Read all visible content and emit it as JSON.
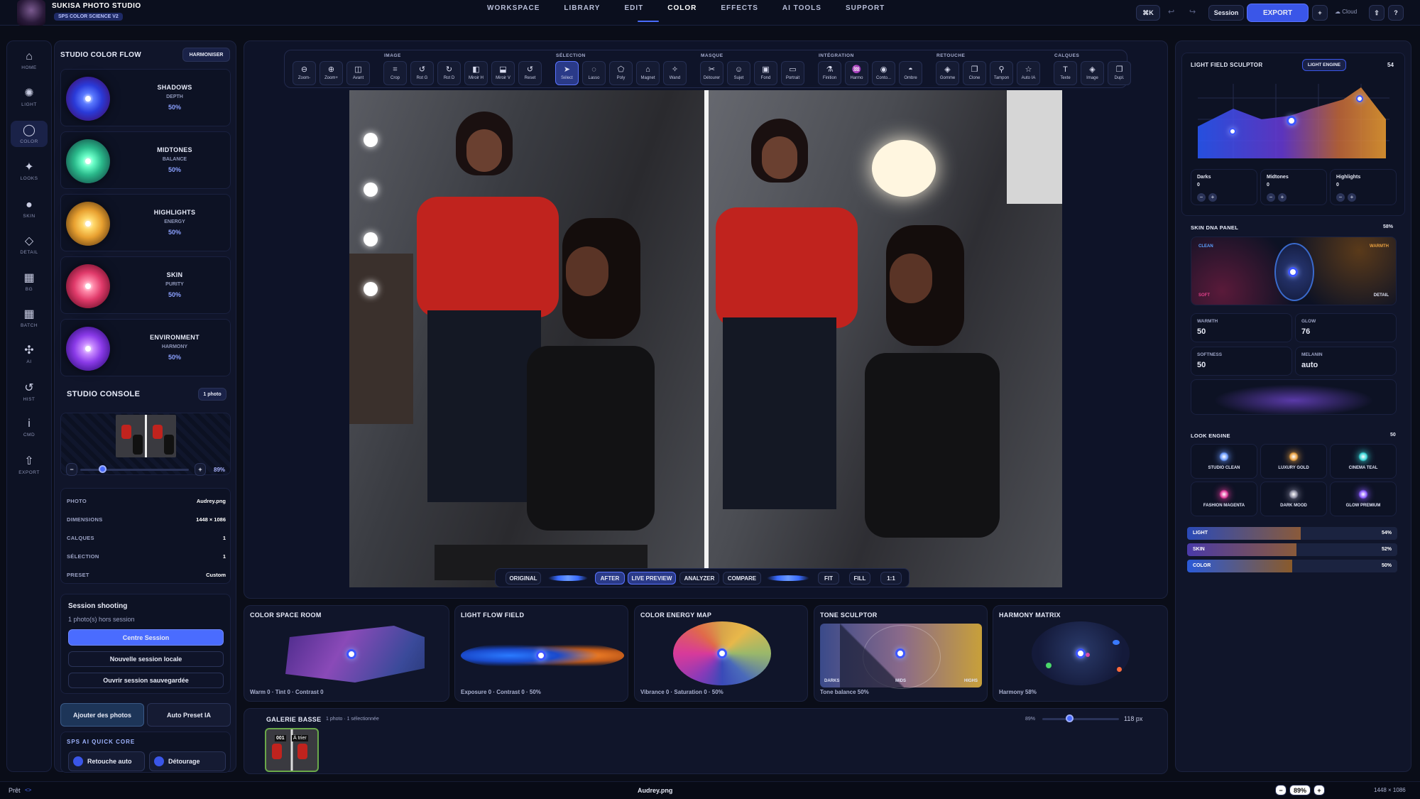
{
  "app": {
    "title": "SUKISA PHOTO STUDIO",
    "subtitle": "SPS COLOR SCIENCE V2"
  },
  "nav": [
    "WORKSPACE",
    "LIBRARY",
    "EDIT",
    "COLOR",
    "EFFECTS",
    "AI TOOLS",
    "SUPPORT"
  ],
  "nav_active": "COLOR",
  "topright": {
    "shortcut": "⌘K",
    "session": "Session",
    "export": "EXPORT",
    "plus": "+",
    "cloud": "Cloud",
    "help": "?"
  },
  "sidebar": [
    {
      "label": "HOME",
      "icon": "home-icon",
      "glyph": "⌂"
    },
    {
      "label": "LIGHT",
      "icon": "sun-icon",
      "glyph": "✺"
    },
    {
      "label": "COLOR",
      "icon": "color-circle-icon",
      "glyph": "◯"
    },
    {
      "label": "LOOKS",
      "icon": "sparkle-icon",
      "glyph": "✦"
    },
    {
      "label": "SKIN",
      "icon": "dot-icon",
      "glyph": "●"
    },
    {
      "label": "DETAIL",
      "icon": "diamond-icon",
      "glyph": "◇"
    },
    {
      "label": "BG",
      "icon": "square-icon",
      "glyph": "▦"
    },
    {
      "label": "BATCH",
      "icon": "batch-icon",
      "glyph": "▦"
    },
    {
      "label": "AI",
      "icon": "move-icon",
      "glyph": "✣"
    },
    {
      "label": "HIST",
      "icon": "history-icon",
      "glyph": "↺"
    },
    {
      "label": "CMD",
      "icon": "info-icon",
      "glyph": "i"
    },
    {
      "label": "EXPORT",
      "icon": "upload-icon",
      "glyph": "⇧"
    }
  ],
  "colorflow": {
    "title": "STUDIO COLOR FLOW",
    "button": "HARMONISER",
    "wheels": [
      {
        "name": "SHADOWS",
        "sub": "DEPTH",
        "value": "50%"
      },
      {
        "name": "MIDTONES",
        "sub": "BALANCE",
        "value": "50%"
      },
      {
        "name": "HIGHLIGHTS",
        "sub": "ENERGY",
        "value": "50%"
      },
      {
        "name": "SKIN",
        "sub": "PURITY",
        "value": "50%"
      },
      {
        "name": "ENVIRONMENT",
        "sub": "HARMONY",
        "value": "50%"
      }
    ]
  },
  "console": {
    "title": "STUDIO CONSOLE",
    "badge": "1 photo",
    "zoom": "89%",
    "minus": "−",
    "plus": "+",
    "zoom_fraction": 0.2,
    "info": [
      {
        "k": "PHOTO",
        "v": "Audrey.png"
      },
      {
        "k": "DIMENSIONS",
        "v": "1448 × 1086"
      },
      {
        "k": "CALQUES",
        "v": "1"
      },
      {
        "k": "SÉLECTION",
        "v": "1"
      },
      {
        "k": "PRESET",
        "v": "Custom"
      }
    ]
  },
  "session": {
    "title": "Session shooting",
    "sub": "1 photo(s) hors session",
    "b1": "Centre Session",
    "b2": "Nouvelle session locale",
    "b3": "Ouvrir session sauvegardée",
    "add": "Ajouter des photos",
    "preset": "Auto Preset IA"
  },
  "quick": {
    "title": "SPS AI QUICK CORE",
    "a": "Retouche auto",
    "b": "Détourage"
  },
  "toolbar": [
    {
      "group": "",
      "tools": [
        "Zoom-",
        "Zoom+",
        "Avant"
      ],
      "glyphs": [
        "⊖",
        "⊕",
        "◫"
      ]
    },
    {
      "group": "IMAGE",
      "tools": [
        "Crop",
        "Rot G",
        "Rot D",
        "Miroir H",
        "Miroir V",
        "Reset"
      ],
      "glyphs": [
        "⌗",
        "↺",
        "↻",
        "◧",
        "⬓",
        "↺"
      ]
    },
    {
      "group": "SÉLECTION",
      "tools": [
        "Sélect",
        "Lasso",
        "Poly",
        "Magnet",
        "Wand"
      ],
      "glyphs": [
        "➤",
        "◌",
        "⬠",
        "⌂",
        "✧"
      ]
    },
    {
      "group": "MASQUE",
      "tools": [
        "Détourer",
        "Sujet",
        "Fond",
        "Portrait"
      ],
      "glyphs": [
        "✂",
        "☺",
        "▣",
        "▭"
      ]
    },
    {
      "group": "INTÉGRATION",
      "tools": [
        "Finition",
        "Harmo",
        "Conto...",
        "Ombre"
      ],
      "glyphs": [
        "⚗",
        "♒",
        "◉",
        "◓"
      ]
    },
    {
      "group": "RETOUCHE",
      "tools": [
        "Gomme",
        "Clone",
        "Tampon",
        "Auto IA"
      ],
      "glyphs": [
        "◈",
        "❐",
        "⚲",
        "☆"
      ]
    },
    {
      "group": "CALQUES",
      "tools": [
        "Texte",
        "Image",
        "Dupl."
      ],
      "glyphs": [
        "T",
        "◈",
        "❐"
      ]
    }
  ],
  "viewbar": [
    "ORIGINAL",
    "AFTER",
    "LIVE PREVIEW",
    "ANALYZER",
    "COMPARE",
    "FIT",
    "FILL",
    "1:1"
  ],
  "bottom": [
    {
      "title": "COLOR SPACE ROOM",
      "caption": "Warm 0 · Tint 0 · Contrast 0"
    },
    {
      "title": "LIGHT FLOW FIELD",
      "caption": "Exposure 0 · Contrast 0 · 50%"
    },
    {
      "title": "COLOR ENERGY MAP",
      "caption": "Vibrance 0 · Saturation 0 · 50%"
    },
    {
      "title": "TONE SCULPTOR",
      "caption": "Tone balance 50%",
      "labels": [
        "DARKS",
        "MIDS",
        "HIGHS"
      ]
    },
    {
      "title": "HARMONY MATRIX",
      "caption": "Harmony 58%"
    }
  ],
  "gallery": {
    "title": "GALERIE BASSE",
    "sub": "1 photo · 1 sélectionnée",
    "zoom": "89%",
    "size": "118 px",
    "thumb_num": "001",
    "thumb_tag": "À trier",
    "size_fraction": 0.35
  },
  "right": {
    "lfs": {
      "title": "LIGHT FIELD SCULPTOR",
      "badge": "LIGHT ENGINE",
      "value": "54",
      "boxes": [
        {
          "k": "Darks",
          "v": "0"
        },
        {
          "k": "Midtones",
          "v": "0"
        },
        {
          "k": "Highlights",
          "v": "0"
        }
      ]
    },
    "skin": {
      "title": "SKIN DNA PANEL",
      "value": "58%",
      "c1": "CLEAN",
      "c2": "WARMTH",
      "c3": "SOFT",
      "c4": "DETAIL",
      "stats": [
        {
          "k": "WARMTH",
          "v": "50"
        },
        {
          "k": "GLOW",
          "v": "76"
        },
        {
          "k": "SOFTNESS",
          "v": "50"
        },
        {
          "k": "MELANIN",
          "v": "auto"
        }
      ]
    },
    "look": {
      "title": "LOOK ENGINE",
      "value": "50",
      "items": [
        "STUDIO CLEAN",
        "LUXURY GOLD",
        "CINEMA TEAL",
        "FASHION MAGENTA",
        "DARK MOOD",
        "GLOW PREMIUM"
      ]
    },
    "bars": [
      {
        "k": "LIGHT",
        "v": "54%",
        "f": 0.54
      },
      {
        "k": "SKIN",
        "v": "52%",
        "f": 0.52
      },
      {
        "k": "COLOR",
        "v": "50%",
        "f": 0.5
      }
    ]
  },
  "status": {
    "left": "Prêt",
    "center": "Audrey.png",
    "zoom": "89%",
    "right": "1448 × 1086",
    "minus": "−",
    "plus": "+"
  }
}
